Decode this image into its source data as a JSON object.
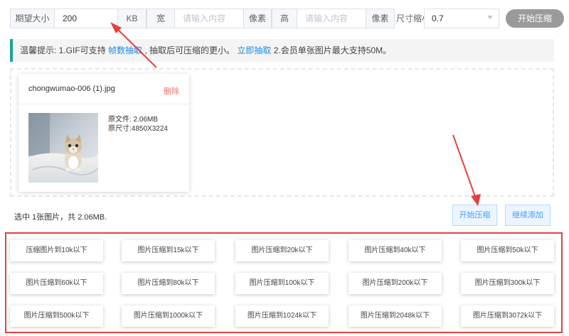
{
  "toolbar": {
    "size_label": "期望大小",
    "size_value": "200",
    "size_unit": "KB",
    "width_label": "宽",
    "width_placeholder": "请输入内容",
    "width_unit": "像素",
    "height_label": "高",
    "height_placeholder": "请输入内容",
    "height_unit": "像素",
    "scale_label": "尺寸缩小",
    "scale_value": "0.7",
    "compress_label": "开始压缩"
  },
  "notice": {
    "prefix": "温馨提示: 1.GIF可支持",
    "link1": "帧数抽取",
    "middle": ", 抽取后可压缩的更小。",
    "link2": "立即抽取",
    "suffix": " 2.会员单张图片最大支持50M。"
  },
  "file": {
    "name": "chongwumao-006 (1).jpg",
    "delete_label": "删除",
    "original_size": "原文件: 2.06MB",
    "original_dims": "原尺寸:4850X3224"
  },
  "summary": "选中 1张图片，共 2.06MB.",
  "actions": {
    "start_label": "开始压缩",
    "continue_label": "继续添加"
  },
  "presets": [
    "压缩图片到10k以下",
    "图片压缩到15k以下",
    "图片压缩到20k以下",
    "图片压缩到40k以下",
    "图片压缩到50k以下",
    "图片压缩到60k以下",
    "图片压缩到80k以下",
    "图片压缩到100k以下",
    "图片压缩到200k以下",
    "图片压缩到300k以下",
    "图片压缩到500k以下",
    "图片压缩到1000k以下",
    "图片压缩到1024k以下",
    "图片压缩到2048k以下",
    "图片压缩到3072k以下"
  ],
  "colors": {
    "accent": "#409eff",
    "annotation": "#e8403f",
    "notice_bar": "#1aa39a",
    "delete": "#f56c6c"
  }
}
